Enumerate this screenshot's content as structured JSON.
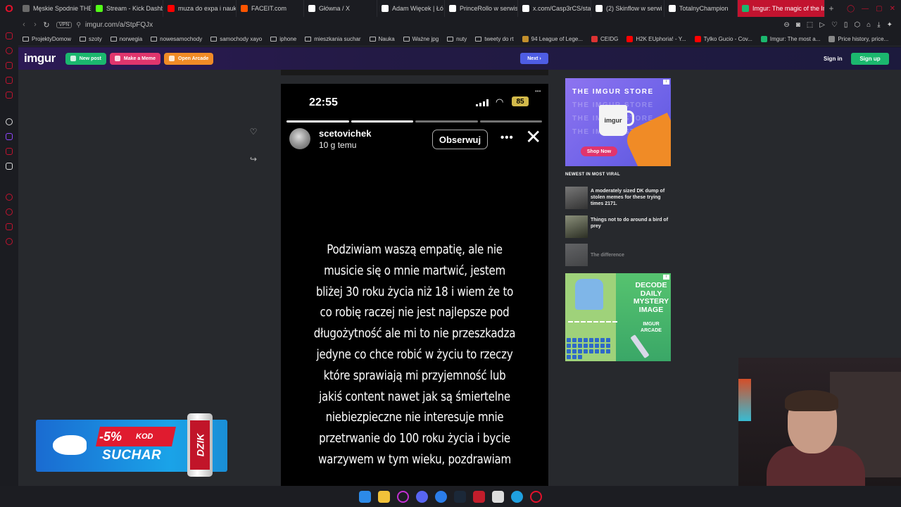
{
  "browser": {
    "tabs": [
      {
        "label": "Męskie Spodnie THE",
        "color": "#6a6a6a"
      },
      {
        "label": "Stream - Kick Dashbo",
        "color": "#53fc18"
      },
      {
        "label": "muza do expa i nauki",
        "color": "#ff0000"
      },
      {
        "label": "FACEIT.com",
        "color": "#ff5500"
      },
      {
        "label": "Główna / X",
        "color": "#ffffff"
      },
      {
        "label": "Adam Więcek | Łó",
        "color": "#ffffff"
      },
      {
        "label": "PrinceRollo w serwis",
        "color": "#ffffff"
      },
      {
        "label": "x.com/Casp3rCS/sta",
        "color": "#ffffff"
      },
      {
        "label": "(2) Skinflow w serwi",
        "color": "#ffffff"
      },
      {
        "label": "TotalnyChampion",
        "color": "#ffffff"
      },
      {
        "label": "Imgur: The magic of the Int",
        "color": "#1bb76e",
        "active": true
      }
    ],
    "url": "imgur.com/a/StpFQJx",
    "vpn_label": "VPN",
    "bookmarks": [
      {
        "label": "ProjektyDomow",
        "type": "folder"
      },
      {
        "label": "szoty",
        "type": "folder"
      },
      {
        "label": "norwegia",
        "type": "folder"
      },
      {
        "label": "nowesamochody",
        "type": "folder"
      },
      {
        "label": "samochody xayo",
        "type": "folder"
      },
      {
        "label": "iphone",
        "type": "folder"
      },
      {
        "label": "mieszkania suchar",
        "type": "folder"
      },
      {
        "label": "Nauka",
        "type": "folder"
      },
      {
        "label": "Ważne jpg",
        "type": "folder"
      },
      {
        "label": "nuty",
        "type": "folder"
      },
      {
        "label": "tweety do rt",
        "type": "folder"
      },
      {
        "label": "94 League of Lege...",
        "type": "site",
        "color": "#c28f2c"
      },
      {
        "label": "CEIDG",
        "type": "site",
        "color": "#d33"
      },
      {
        "label": "H2K EUphoria! - Y...",
        "type": "site",
        "color": "#ff0000"
      },
      {
        "label": "Tylko Gucio - Cov...",
        "type": "site",
        "color": "#ff0000"
      },
      {
        "label": "Imgur: The most a...",
        "type": "site",
        "color": "#1bb76e"
      },
      {
        "label": "Price history, price...",
        "type": "site",
        "color": "#888888"
      }
    ]
  },
  "imgur": {
    "logo": "imgur",
    "new_post": "New post",
    "make_meme": "Make a Meme",
    "open_arcade": "Open Arcade",
    "next": "Next",
    "sign_in": "Sign in",
    "sign_up": "Sign up",
    "colors": {
      "new_post": "#1bb76e",
      "make_meme": "#e0356d",
      "open_arcade": "#f08b26",
      "next": "#4e5de3"
    }
  },
  "story": {
    "time": "22:55",
    "battery": "85",
    "username": "scetovichek",
    "post_time": "10 g temu",
    "follow": "Obserwuj",
    "text": "Podziwiam waszą empatię, ale nie musicie się o mnie martwić, jestem bliżej 30 roku życia niż 18 i wiem że to co robię raczej nie jest najlepsze pod długożytność ale mi to nie przeszkadza jedyne co chce robić w życiu to rzeczy które sprawiają mi przyjemność lub jakiś content nawet jak są śmiertelne niebiezpieczne nie interesuje mnie przetrwanie do 100 roku życia i bycie warzywem w tym wieku, pozdrawiam"
  },
  "sidebar_right": {
    "store_ad": {
      "title": "THE IMGUR STORE",
      "ghost": "THE IMGUR STORE",
      "mug": "imgur",
      "cta": "Shop Now"
    },
    "newest_title": "NEWEST IN MOST VIRAL",
    "viral": [
      {
        "title": "A moderately sized DK dump of stolen memes for these trying times 2171."
      },
      {
        "title": "Things not to do around a bird of prey"
      },
      {
        "title": "The difference"
      }
    ],
    "arcade_ad": {
      "headline": "DECODE DAILY MYSTERY IMAGE",
      "brand": "IMGUR ARCADE"
    }
  },
  "promo": {
    "discount": "-5%",
    "kod": "KOD",
    "code": "SUCHAR",
    "can_label": "DZIK"
  }
}
